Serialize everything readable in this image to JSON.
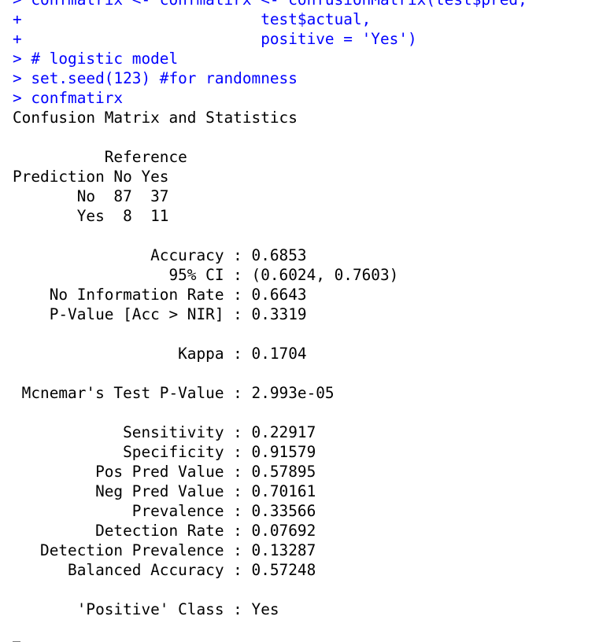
{
  "console": {
    "lines": [
      {
        "type": "cmd",
        "text": "> confmatrix <- confmatirx <- confusionMatrix(test$pred,"
      },
      {
        "type": "cmd",
        "text": "+                          test$actual,"
      },
      {
        "type": "cmd",
        "text": "+                          positive = 'Yes')"
      },
      {
        "type": "cmd",
        "text": "> # logistic model"
      },
      {
        "type": "cmd",
        "text": "> set.seed(123) #for randomness"
      },
      {
        "type": "cmd",
        "text": "> confmatirx"
      },
      {
        "type": "out",
        "text": "Confusion Matrix and Statistics"
      },
      {
        "type": "out",
        "text": ""
      },
      {
        "type": "out",
        "text": "          Reference"
      },
      {
        "type": "out",
        "text": "Prediction No Yes"
      },
      {
        "type": "out",
        "text": "       No  87  37"
      },
      {
        "type": "out",
        "text": "       Yes  8  11"
      },
      {
        "type": "out",
        "text": ""
      },
      {
        "type": "out",
        "text": "               Accuracy : 0.6853"
      },
      {
        "type": "out",
        "text": "                 95% CI : (0.6024, 0.7603)"
      },
      {
        "type": "out",
        "text": "    No Information Rate : 0.6643"
      },
      {
        "type": "out",
        "text": "    P-Value [Acc > NIR] : 0.3319"
      },
      {
        "type": "out",
        "text": ""
      },
      {
        "type": "out",
        "text": "                  Kappa : 0.1704"
      },
      {
        "type": "out",
        "text": ""
      },
      {
        "type": "out",
        "text": " Mcnemar's Test P-Value : 2.993e-05"
      },
      {
        "type": "out",
        "text": ""
      },
      {
        "type": "out",
        "text": "            Sensitivity : 0.22917"
      },
      {
        "type": "out",
        "text": "            Specificity : 0.91579"
      },
      {
        "type": "out",
        "text": "         Pos Pred Value : 0.57895"
      },
      {
        "type": "out",
        "text": "         Neg Pred Value : 0.70161"
      },
      {
        "type": "out",
        "text": "             Prevalence : 0.33566"
      },
      {
        "type": "out",
        "text": "         Detection Rate : 0.07692"
      },
      {
        "type": "out",
        "text": "   Detection Prevalence : 0.13287"
      },
      {
        "type": "out",
        "text": "      Balanced Accuracy : 0.57248"
      },
      {
        "type": "out",
        "text": ""
      },
      {
        "type": "out",
        "text": "       'Positive' Class : Yes"
      },
      {
        "type": "out",
        "text": ""
      }
    ]
  },
  "colors": {
    "command": "#0000ff",
    "output": "#000000",
    "background": "#ffffff"
  }
}
